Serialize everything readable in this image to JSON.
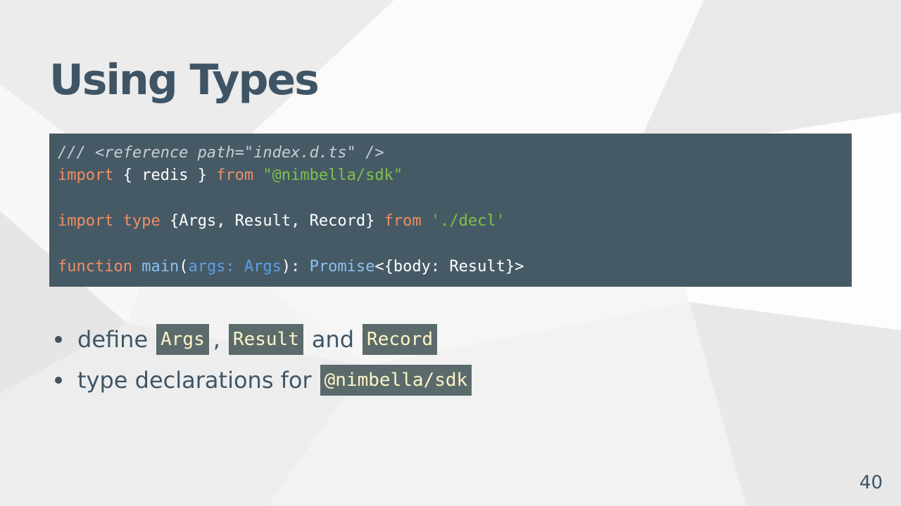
{
  "slide": {
    "title": "Using Types",
    "page_number": "40"
  },
  "code_block": {
    "line1": {
      "comment": "/// <reference path=\"index.d.ts\" />"
    },
    "line2": {
      "kw_import": "import",
      "braces": " { redis } ",
      "kw_from": "from",
      "space": " ",
      "string": "\"@nimbella/sdk\""
    },
    "line4": {
      "kw_import": "import",
      "space1": " ",
      "kw_type": "type",
      "names": " {Args, Result, Record} ",
      "kw_from": "from",
      "space2": " ",
      "string": "'./decl'"
    },
    "line6": {
      "kw_function": "function",
      "space": " ",
      "fn_name": "main",
      "open_paren": "(",
      "param": "args:",
      "space2": " ",
      "param_type": "Args",
      "close": "): ",
      "return_type": "Promise",
      "generic": "<{body: Result}>"
    }
  },
  "bullets": [
    {
      "text1": "define",
      "code1": "Args",
      "sep1": ",",
      "code2": "Result",
      "text2": "and",
      "code3": "Record"
    },
    {
      "text1": "type declarations for",
      "code1": "@nimbella/sdk"
    }
  ],
  "colors": {
    "title": "#3f5566",
    "code_bg": "#465a66",
    "keyword": "#f08d63",
    "string": "#7ec248",
    "function": "#8fc0f0",
    "type": "#5aa0e6",
    "inline_code_bg": "#5b6b6c",
    "inline_code_text": "#fff3c6"
  }
}
